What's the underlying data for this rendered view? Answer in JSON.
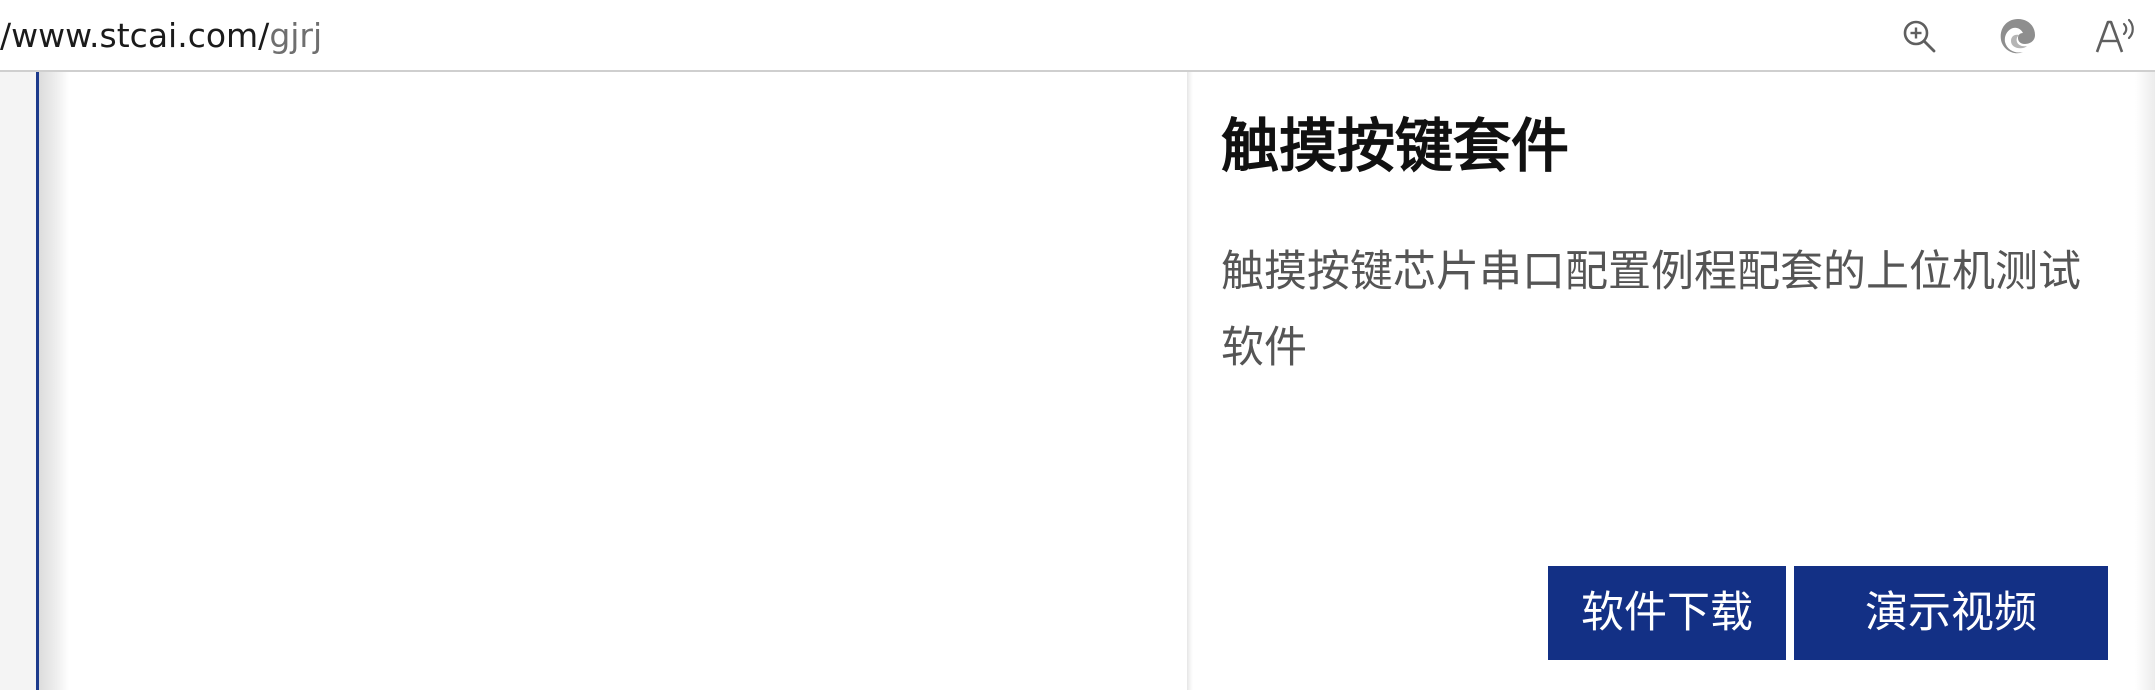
{
  "browser": {
    "url_main": "/www.stcai.com/",
    "url_path": "gjrj",
    "toolbar": {
      "zoom_icon": "zoom-in-icon",
      "edge_icon": "edge-copilot-icon",
      "read_aloud_icon": "read-aloud-icon"
    }
  },
  "product": {
    "title": "触摸按键套件",
    "description": "触摸按键芯片串口配置例程配套的上位机测试软件",
    "buttons": {
      "download_label": "软件下载",
      "video_label": "演示视频"
    }
  },
  "colors": {
    "button_bg": "#133085",
    "button_text": "#ffffff",
    "accent_rule": "#1c3a8c",
    "title_text": "#111111",
    "description_text": "#555555"
  }
}
